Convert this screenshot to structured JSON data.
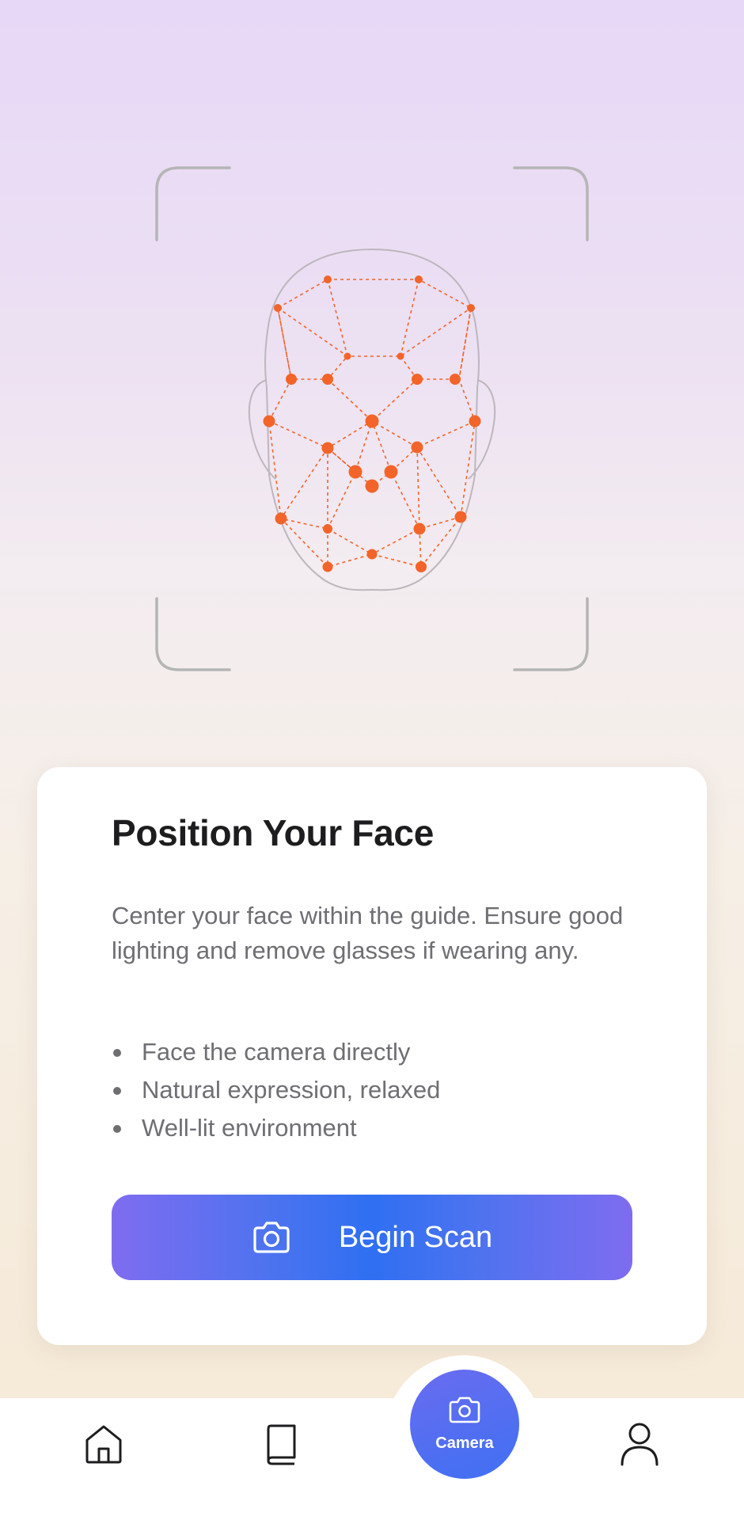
{
  "colors": {
    "accent_orange": "#F2642A",
    "button_gradient_center": "#2F6FF2",
    "button_gradient_edge": "#7F6CF0",
    "title_text": "#1D1D1F",
    "body_text": "#6E6E73"
  },
  "scan_guide": {
    "frame": "corner-bracket-frame",
    "face": "face-mesh-outline"
  },
  "card": {
    "title": "Position Your Face",
    "description": "Center your face within the guide. Ensure good lighting and remove glasses if wearing any.",
    "tips": [
      "Face the camera directly",
      "Natural expression, relaxed",
      "Well-lit environment"
    ],
    "button": {
      "label": "Begin Scan",
      "icon": "camera-icon"
    }
  },
  "bottom_nav": {
    "items": [
      {
        "icon": "home-icon"
      },
      {
        "icon": "book-icon"
      },
      {
        "icon": "camera-icon",
        "label": "Camera",
        "active": true
      },
      {
        "icon": "profile-icon"
      }
    ]
  }
}
